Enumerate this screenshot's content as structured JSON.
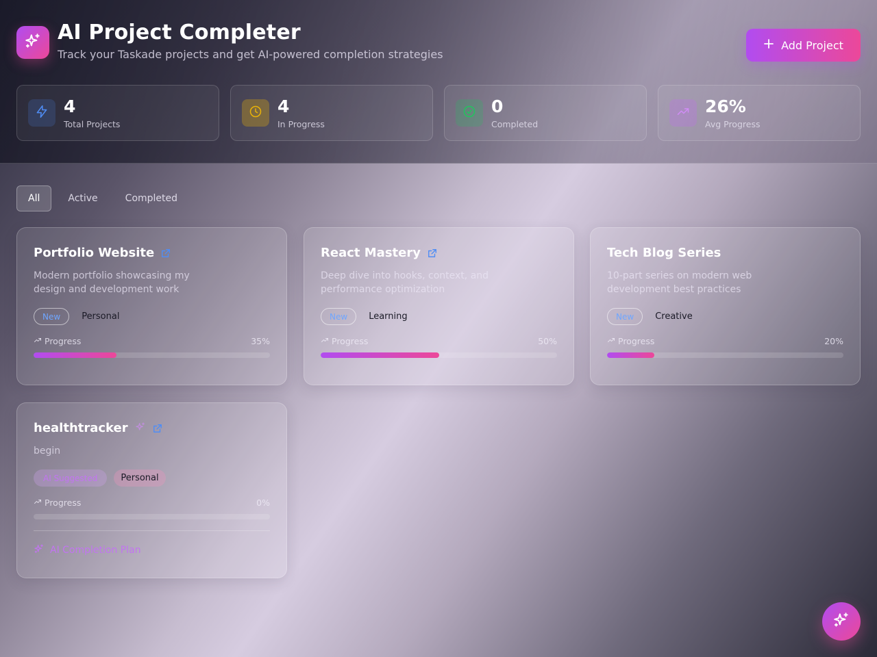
{
  "header": {
    "title": "AI Project Completer",
    "subtitle": "Track your Taskade projects and get AI-powered completion strategies",
    "add_button_label": "Add Project",
    "logo_icon": "sparkles-icon"
  },
  "stats": [
    {
      "value": "4",
      "label": "Total Projects",
      "icon": "lightning-icon",
      "color": "#4f8df5"
    },
    {
      "value": "4",
      "label": "In Progress",
      "icon": "clock-icon",
      "color": "#eab308"
    },
    {
      "value": "0",
      "label": "Completed",
      "icon": "check-circle-icon",
      "color": "#22c55e"
    },
    {
      "value": "26%",
      "label": "Avg Progress",
      "icon": "trending-up-icon",
      "color": "#c26cf0"
    }
  ],
  "tabs": [
    {
      "label": "All",
      "active": true
    },
    {
      "label": "Active",
      "active": false
    },
    {
      "label": "Completed",
      "active": false
    }
  ],
  "projects": [
    {
      "title": "Portfolio Website",
      "description": "Modern portfolio showcasing my design and development work",
      "status": "New",
      "category": "Personal",
      "progress_label": "Progress",
      "progress_text": "35%",
      "progress": 35
    },
    {
      "title": "React Mastery",
      "description": "Deep dive into hooks, context, and performance optimization",
      "status": "New",
      "category": "Learning",
      "progress_label": "Progress",
      "progress_text": "50%",
      "progress": 50
    },
    {
      "title": "Tech Blog Series",
      "description": "10-part series on modern web development best practices",
      "status": "New",
      "category": "Creative",
      "progress_label": "Progress",
      "progress_text": "20%",
      "progress": 20
    },
    {
      "title": "healthtracker",
      "description": "begin",
      "status": "AI Suggested",
      "category": "Personal",
      "progress_label": "Progress",
      "progress_text": "0%",
      "progress": 0,
      "ai_plan_label": "AI Completion Plan"
    }
  ],
  "colors": {
    "accent_purple": "#b14cf0",
    "accent_pink": "#ec4899",
    "link_blue": "#4f8df5"
  }
}
